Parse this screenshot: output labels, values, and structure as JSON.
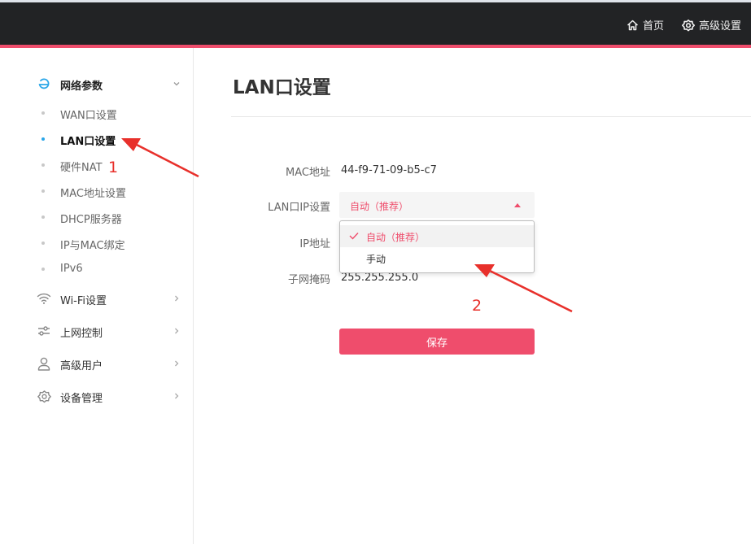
{
  "topbar": {
    "home_label": "首页",
    "advanced_label": "高级设置",
    "accent_color": "#ef4d6c"
  },
  "sidebar": {
    "groups": [
      {
        "label": "网络参数",
        "icon": "network-e-icon",
        "expanded": true,
        "items": [
          {
            "label": "WAN口设置"
          },
          {
            "label": "LAN口设置",
            "active": true
          },
          {
            "label": "硬件NAT"
          },
          {
            "label": "MAC地址设置"
          },
          {
            "label": "DHCP服务器"
          },
          {
            "label": "IP与MAC绑定"
          },
          {
            "label": "IPv6"
          }
        ]
      },
      {
        "label": "Wi-Fi设置",
        "icon": "wifi-icon"
      },
      {
        "label": "上网控制",
        "icon": "sliders-icon"
      },
      {
        "label": "高级用户",
        "icon": "user-icon"
      },
      {
        "label": "设备管理",
        "icon": "gear-icon"
      }
    ]
  },
  "main": {
    "title": "LAN口设置",
    "fields": {
      "mac_label": "MAC地址",
      "mac_value": "44-f9-71-09-b5-c7",
      "lan_ip_label": "LAN口IP设置",
      "ip_label": "IP地址",
      "subnet_label": "子网掩码",
      "subnet_value": "255.255.255.0"
    },
    "select": {
      "selected": "自动（推荐）",
      "options": [
        "自动（推荐）",
        "手动"
      ]
    },
    "save_label": "保存"
  },
  "annotations": {
    "marker_1": "1",
    "marker_2": "2",
    "color": "#e8302b"
  }
}
